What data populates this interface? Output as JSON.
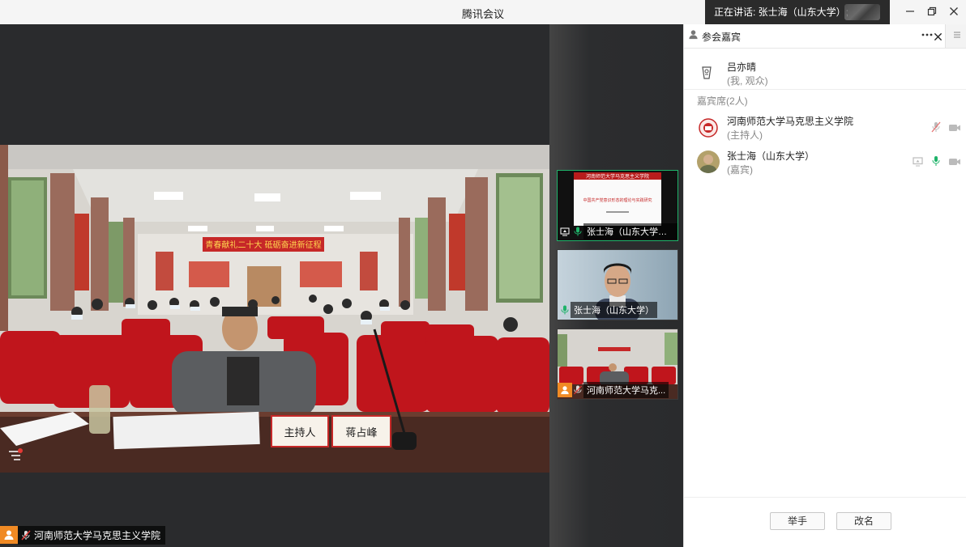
{
  "window": {
    "title": "腾讯会议",
    "speaking": "正在讲话: 张士海（山东大学）;",
    "min_icon": "minimize-icon",
    "restore_icon": "restore-icon",
    "close_icon": "close-icon"
  },
  "main_video": {
    "banner": "青春献礼二十大  砥砺奋进新征程",
    "nameplate_left": "主持人",
    "nameplate_right": "蒋占峰",
    "label": "河南师范大学马克思主义学院"
  },
  "thumbnails": [
    {
      "label": "张士海（山东大学）...",
      "slide_title": "河南师范大学马克思主义学院",
      "slide_text": "中国共产党意识形态的理论与实践研究",
      "icon": "screen-share-icon"
    },
    {
      "label": "张士海（山东大学）",
      "icon": "mic-icon"
    },
    {
      "label": "河南师范大学马克...",
      "icon": "user-avatar-icon"
    }
  ],
  "panel": {
    "title": "参会嘉宾",
    "more_icon": "more-icon",
    "close_icon": "close-icon",
    "self": {
      "name": "吕亦晴",
      "role": "(我, 观众)"
    },
    "section": "嘉宾席(2人)",
    "guests": [
      {
        "name": "河南师范大学马克思主义学院",
        "role": "(主持人)",
        "mic": "mic-muted-icon",
        "cam": "camera-off-icon"
      },
      {
        "name": "张士海（山东大学）",
        "role": "(嘉宾)",
        "mic": "mic-active-icon",
        "cam": "camera-off-icon",
        "screen": "screen-share-icon"
      }
    ],
    "raise_hand": "举手",
    "rename": "改名"
  },
  "colors": {
    "accent": "#1fb36a",
    "orange": "#f08a24",
    "dark": "#2a2b2d"
  }
}
